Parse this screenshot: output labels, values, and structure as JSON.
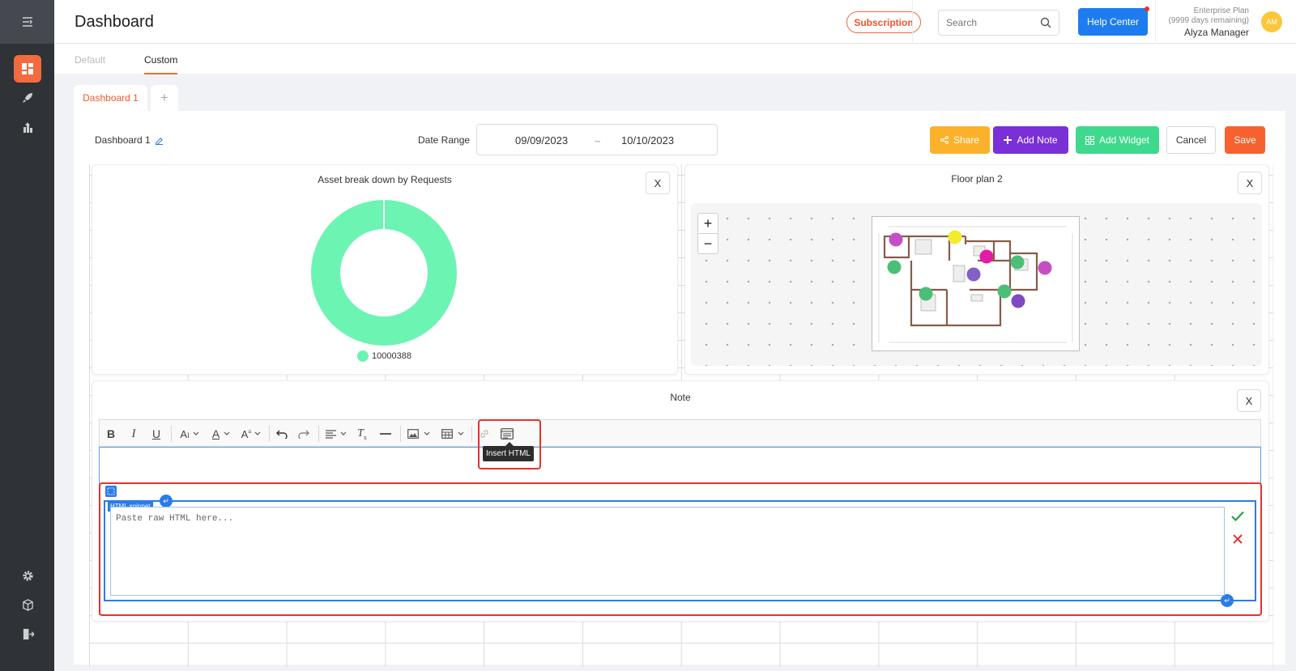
{
  "header": {
    "title": "Dashboard",
    "subscription_label": "Subscription",
    "search_placeholder": "Search",
    "help_label": "Help Center",
    "plan_name": "Enterprise Plan",
    "plan_days": "(9999 days remaining)",
    "user_name": "Alyza Manager",
    "avatar_initials": "AM"
  },
  "view_tabs": {
    "default": "Default",
    "custom": "Custom"
  },
  "dashboard_tabs": {
    "active": "Dashboard 1",
    "add": "+"
  },
  "toolbar": {
    "dashboard_name": "Dashboard 1",
    "date_range_label": "Date Range",
    "date_from": "09/09/2023",
    "date_sep": "~",
    "date_to": "10/10/2023",
    "share": "Share",
    "add_note": "Add Note",
    "add_widget": "Add Widget",
    "cancel": "Cancel",
    "save": "Save"
  },
  "widgets": {
    "donut": {
      "title": "Asset break down by Requests",
      "close": "X",
      "chart_data": {
        "type": "pie",
        "categories": [
          "10000388"
        ],
        "values": [
          100
        ],
        "colors": [
          "#6cf4b3"
        ],
        "legend": "bottom"
      }
    },
    "floor": {
      "title": "Floor plan 2",
      "close": "X",
      "zoom_in": "+",
      "zoom_out": "−",
      "markers": [
        {
          "color": "#c44fc4"
        },
        {
          "color": "#f2ec2c"
        },
        {
          "color": "#e31ca7"
        },
        {
          "color": "#4cbf77"
        },
        {
          "color": "#c44fc4"
        },
        {
          "color": "#4cbf77"
        },
        {
          "color": "#8061c9"
        },
        {
          "color": "#4cbf77"
        },
        {
          "color": "#4cbf77"
        },
        {
          "color": "#7e49c2"
        }
      ]
    },
    "note": {
      "title": "Note",
      "close": "X",
      "tooltip": "Insert HTML",
      "snippet_label": "HTML snippet",
      "snippet_placeholder": "Paste raw HTML here..."
    }
  },
  "colors": {
    "accent": "#f26a3d",
    "help": "#1f7cf0",
    "share": "#fbb22a",
    "add_note": "#7b2fd6",
    "add_widget": "#3fd98e",
    "save": "#f5622f",
    "highlight": "#e5322a",
    "snippet": "#2b7ce9"
  }
}
